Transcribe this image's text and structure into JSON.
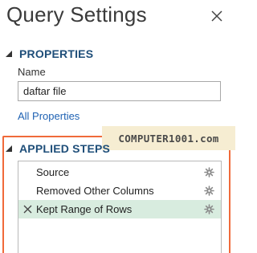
{
  "pane": {
    "title": "Query Settings"
  },
  "properties": {
    "heading": "PROPERTIES",
    "name_label": "Name",
    "name_value": "daftar file",
    "all_properties_link": "All Properties"
  },
  "watermark": "COMPUTER1001.com",
  "applied_steps": {
    "heading": "APPLIED STEPS",
    "steps": [
      {
        "label": "Source",
        "selected": false
      },
      {
        "label": "Removed Other Columns",
        "selected": false
      },
      {
        "label": "Kept Range of Rows",
        "selected": true
      }
    ]
  },
  "colors": {
    "section_heading": "#1e4e79",
    "link": "#1f62b3",
    "selected_step_bg": "#d8ecdf",
    "highlight_border": "#f06a3a",
    "watermark_bg": "#f6edd2"
  }
}
